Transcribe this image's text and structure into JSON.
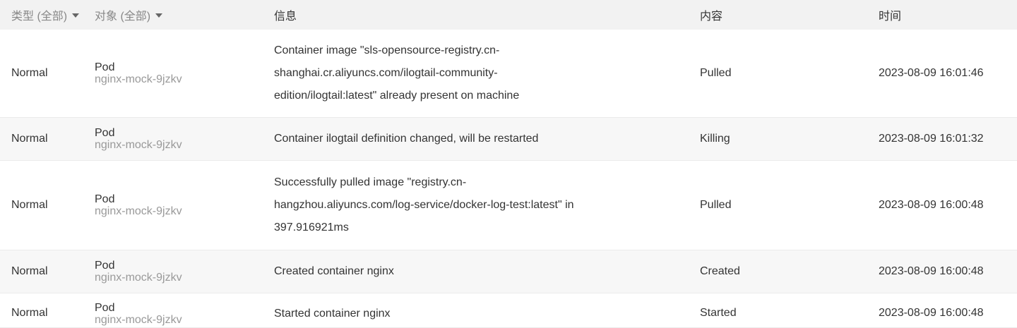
{
  "columns": {
    "type": "类型 (全部)",
    "object": "对象 (全部)",
    "info": "信息",
    "content": "内容",
    "time": "时间"
  },
  "rows": [
    {
      "type": "Normal",
      "object_kind": "Pod",
      "object_name": "nginx-mock-9jzkv",
      "info_lines": [
        "Container image \"sls-opensource-registry.cn-",
        "shanghai.cr.aliyuncs.com/ilogtail-community-",
        "edition/ilogtail:latest\" already present on machine"
      ],
      "content": "Pulled",
      "time": "2023-08-09 16:01:46"
    },
    {
      "type": "Normal",
      "object_kind": "Pod",
      "object_name": "nginx-mock-9jzkv",
      "info_lines": [
        "Container ilogtail definition changed, will be restarted"
      ],
      "content": "Killing",
      "time": "2023-08-09 16:01:32"
    },
    {
      "type": "Normal",
      "object_kind": "Pod",
      "object_name": "nginx-mock-9jzkv",
      "info_lines": [
        "Successfully pulled image \"registry.cn-",
        "hangzhou.aliyuncs.com/log-service/docker-log-test:latest\" in",
        "397.916921ms"
      ],
      "content": "Pulled",
      "time": "2023-08-09 16:00:48"
    },
    {
      "type": "Normal",
      "object_kind": "Pod",
      "object_name": "nginx-mock-9jzkv",
      "info_lines": [
        "Created container nginx"
      ],
      "content": "Created",
      "time": "2023-08-09 16:00:48"
    },
    {
      "type": "Normal",
      "object_kind": "Pod",
      "object_name": "nginx-mock-9jzkv",
      "info_lines": [
        "Started container nginx"
      ],
      "content": "Started",
      "time": "2023-08-09 16:00:48"
    }
  ]
}
